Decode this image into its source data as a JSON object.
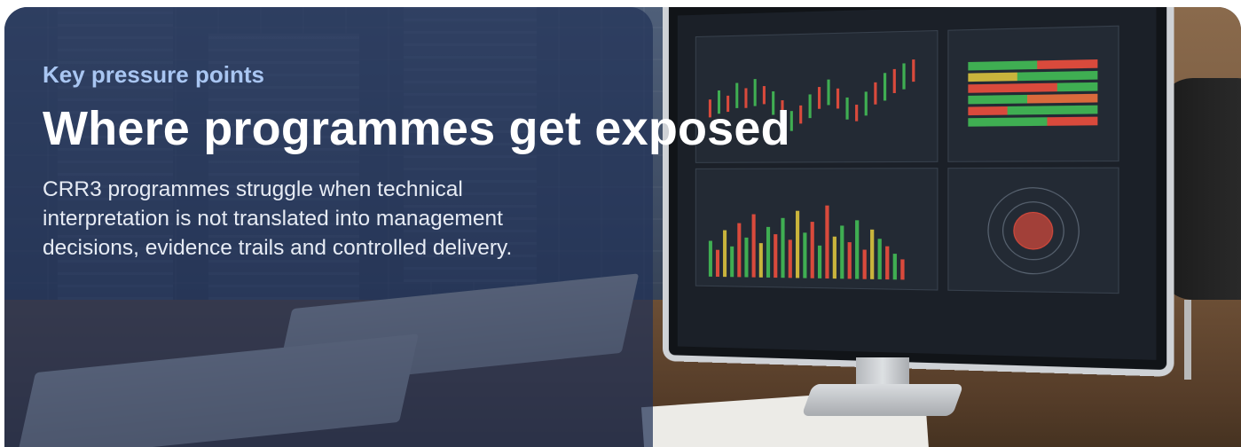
{
  "hero": {
    "eyebrow": "Key pressure points",
    "title": "Where programmes get exposed",
    "description": "CRR3 programmes struggle when technical interpretation is not translated into management decisions, evidence trails and controlled delivery."
  },
  "colors": {
    "overlay": "#213258",
    "eyebrow": "#a9c6f2",
    "title": "#ffffff",
    "description": "#e6ebf4"
  }
}
